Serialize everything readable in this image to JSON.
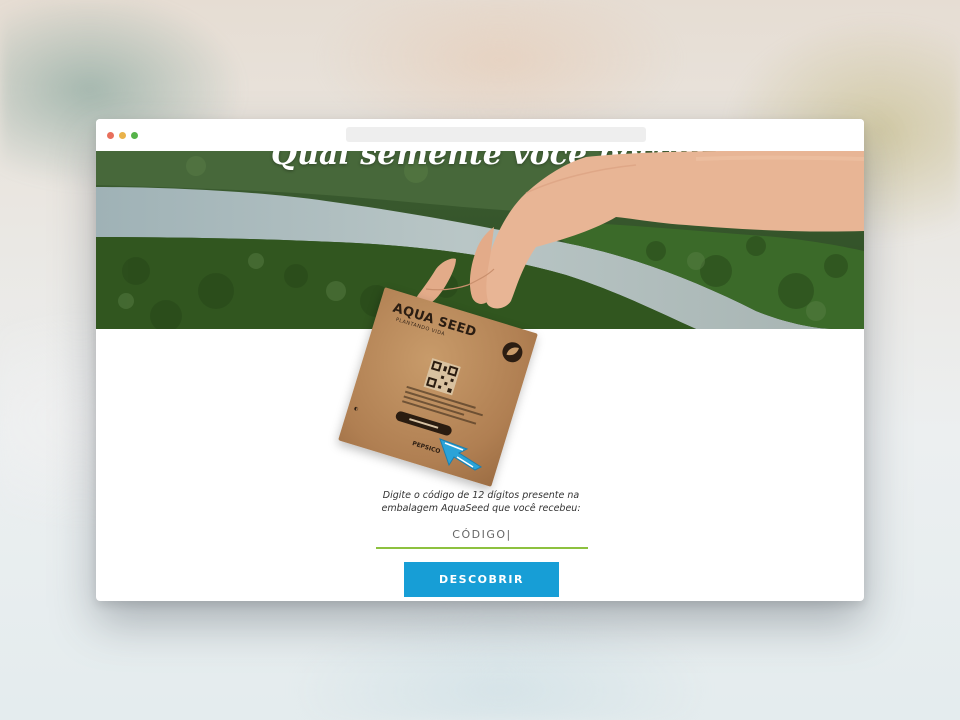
{
  "page": {
    "background_accent": "#8dc13f",
    "button_color": "#179ed6"
  },
  "browser": {
    "window_controls": [
      "close-dot",
      "minimize-dot",
      "maximize-dot"
    ]
  },
  "hero": {
    "title": "Qual semente você possui?"
  },
  "packet": {
    "brand": "AQUA SEED",
    "brand_subtitle": "PLANTANDO VIDA",
    "footer_logo": "PEPSICO"
  },
  "form": {
    "instruction": "Digite o código de 12 dígitos presente na embalagem AquaSeed que você recebeu:",
    "code_value": "CÓDIGO|",
    "submit_label": "DESCOBRIR"
  }
}
